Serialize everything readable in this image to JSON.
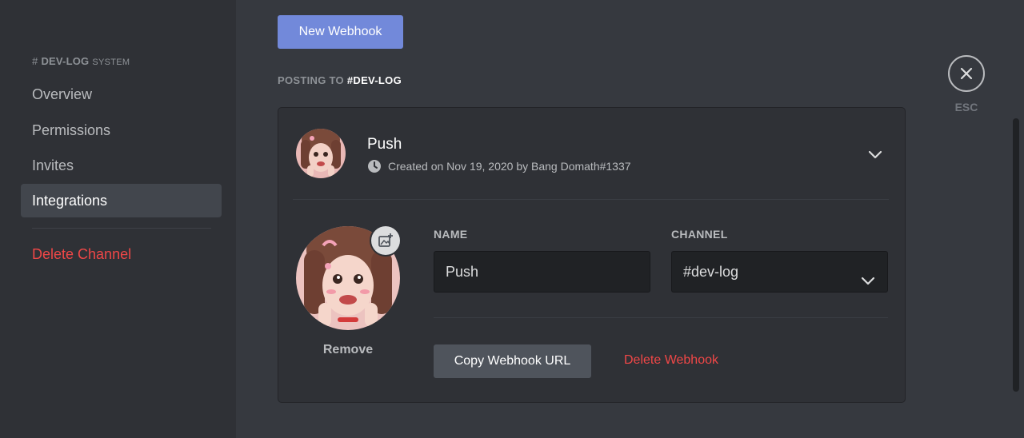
{
  "sidebar": {
    "header": {
      "hash": "#",
      "channel": "DEV-LOG",
      "tag": "SYSTEM"
    },
    "items": [
      {
        "label": "Overview"
      },
      {
        "label": "Permissions"
      },
      {
        "label": "Invites"
      },
      {
        "label": "Integrations",
        "active": true
      },
      {
        "label": "Delete Channel",
        "danger": true
      }
    ]
  },
  "main": {
    "new_webhook_label": "New Webhook",
    "posting_prefix": "POSTING TO",
    "posting_channel": "#DEV-LOG",
    "webhook": {
      "name": "Push",
      "meta": "Created on Nov 19, 2020 by Bang Domath#1337",
      "name_label": "NAME",
      "name_value": "Push",
      "channel_label": "CHANNEL",
      "channel_value": "#dev-log",
      "remove_label": "Remove",
      "copy_label": "Copy Webhook URL",
      "delete_label": "Delete Webhook"
    }
  },
  "esc": {
    "label": "ESC"
  },
  "colors": {
    "accent": "#7289da",
    "danger": "#f04747",
    "bg_main": "#36393f",
    "bg_sidebar": "#2f3136"
  },
  "icons": [
    "clock-icon",
    "chevron-down-icon",
    "add-image-icon",
    "close-icon"
  ]
}
